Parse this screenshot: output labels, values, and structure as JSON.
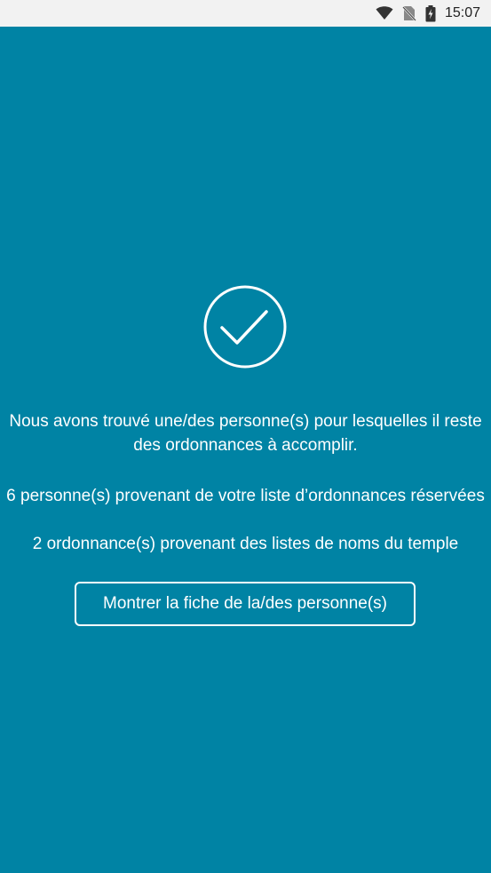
{
  "status_bar": {
    "time": "15:07",
    "icons": [
      "wifi-icon",
      "no-sim-icon",
      "battery-charging-icon"
    ]
  },
  "main": {
    "icon": "check-circle-icon",
    "message": "Nous avons trouvé une/des personne(s) pour lesquelles il reste des ordonnances à accomplir.",
    "count_reserved": "6 personne(s) provenant de votre liste d’ordonnances réservées",
    "count_temple": "2 ordonnance(s) provenant des listes de noms du temple",
    "button_label": "Montrer la fiche de la/des personne(s)"
  },
  "colors": {
    "background": "#0083a4",
    "status_bar": "#f2f2f2",
    "foreground": "#ffffff"
  }
}
